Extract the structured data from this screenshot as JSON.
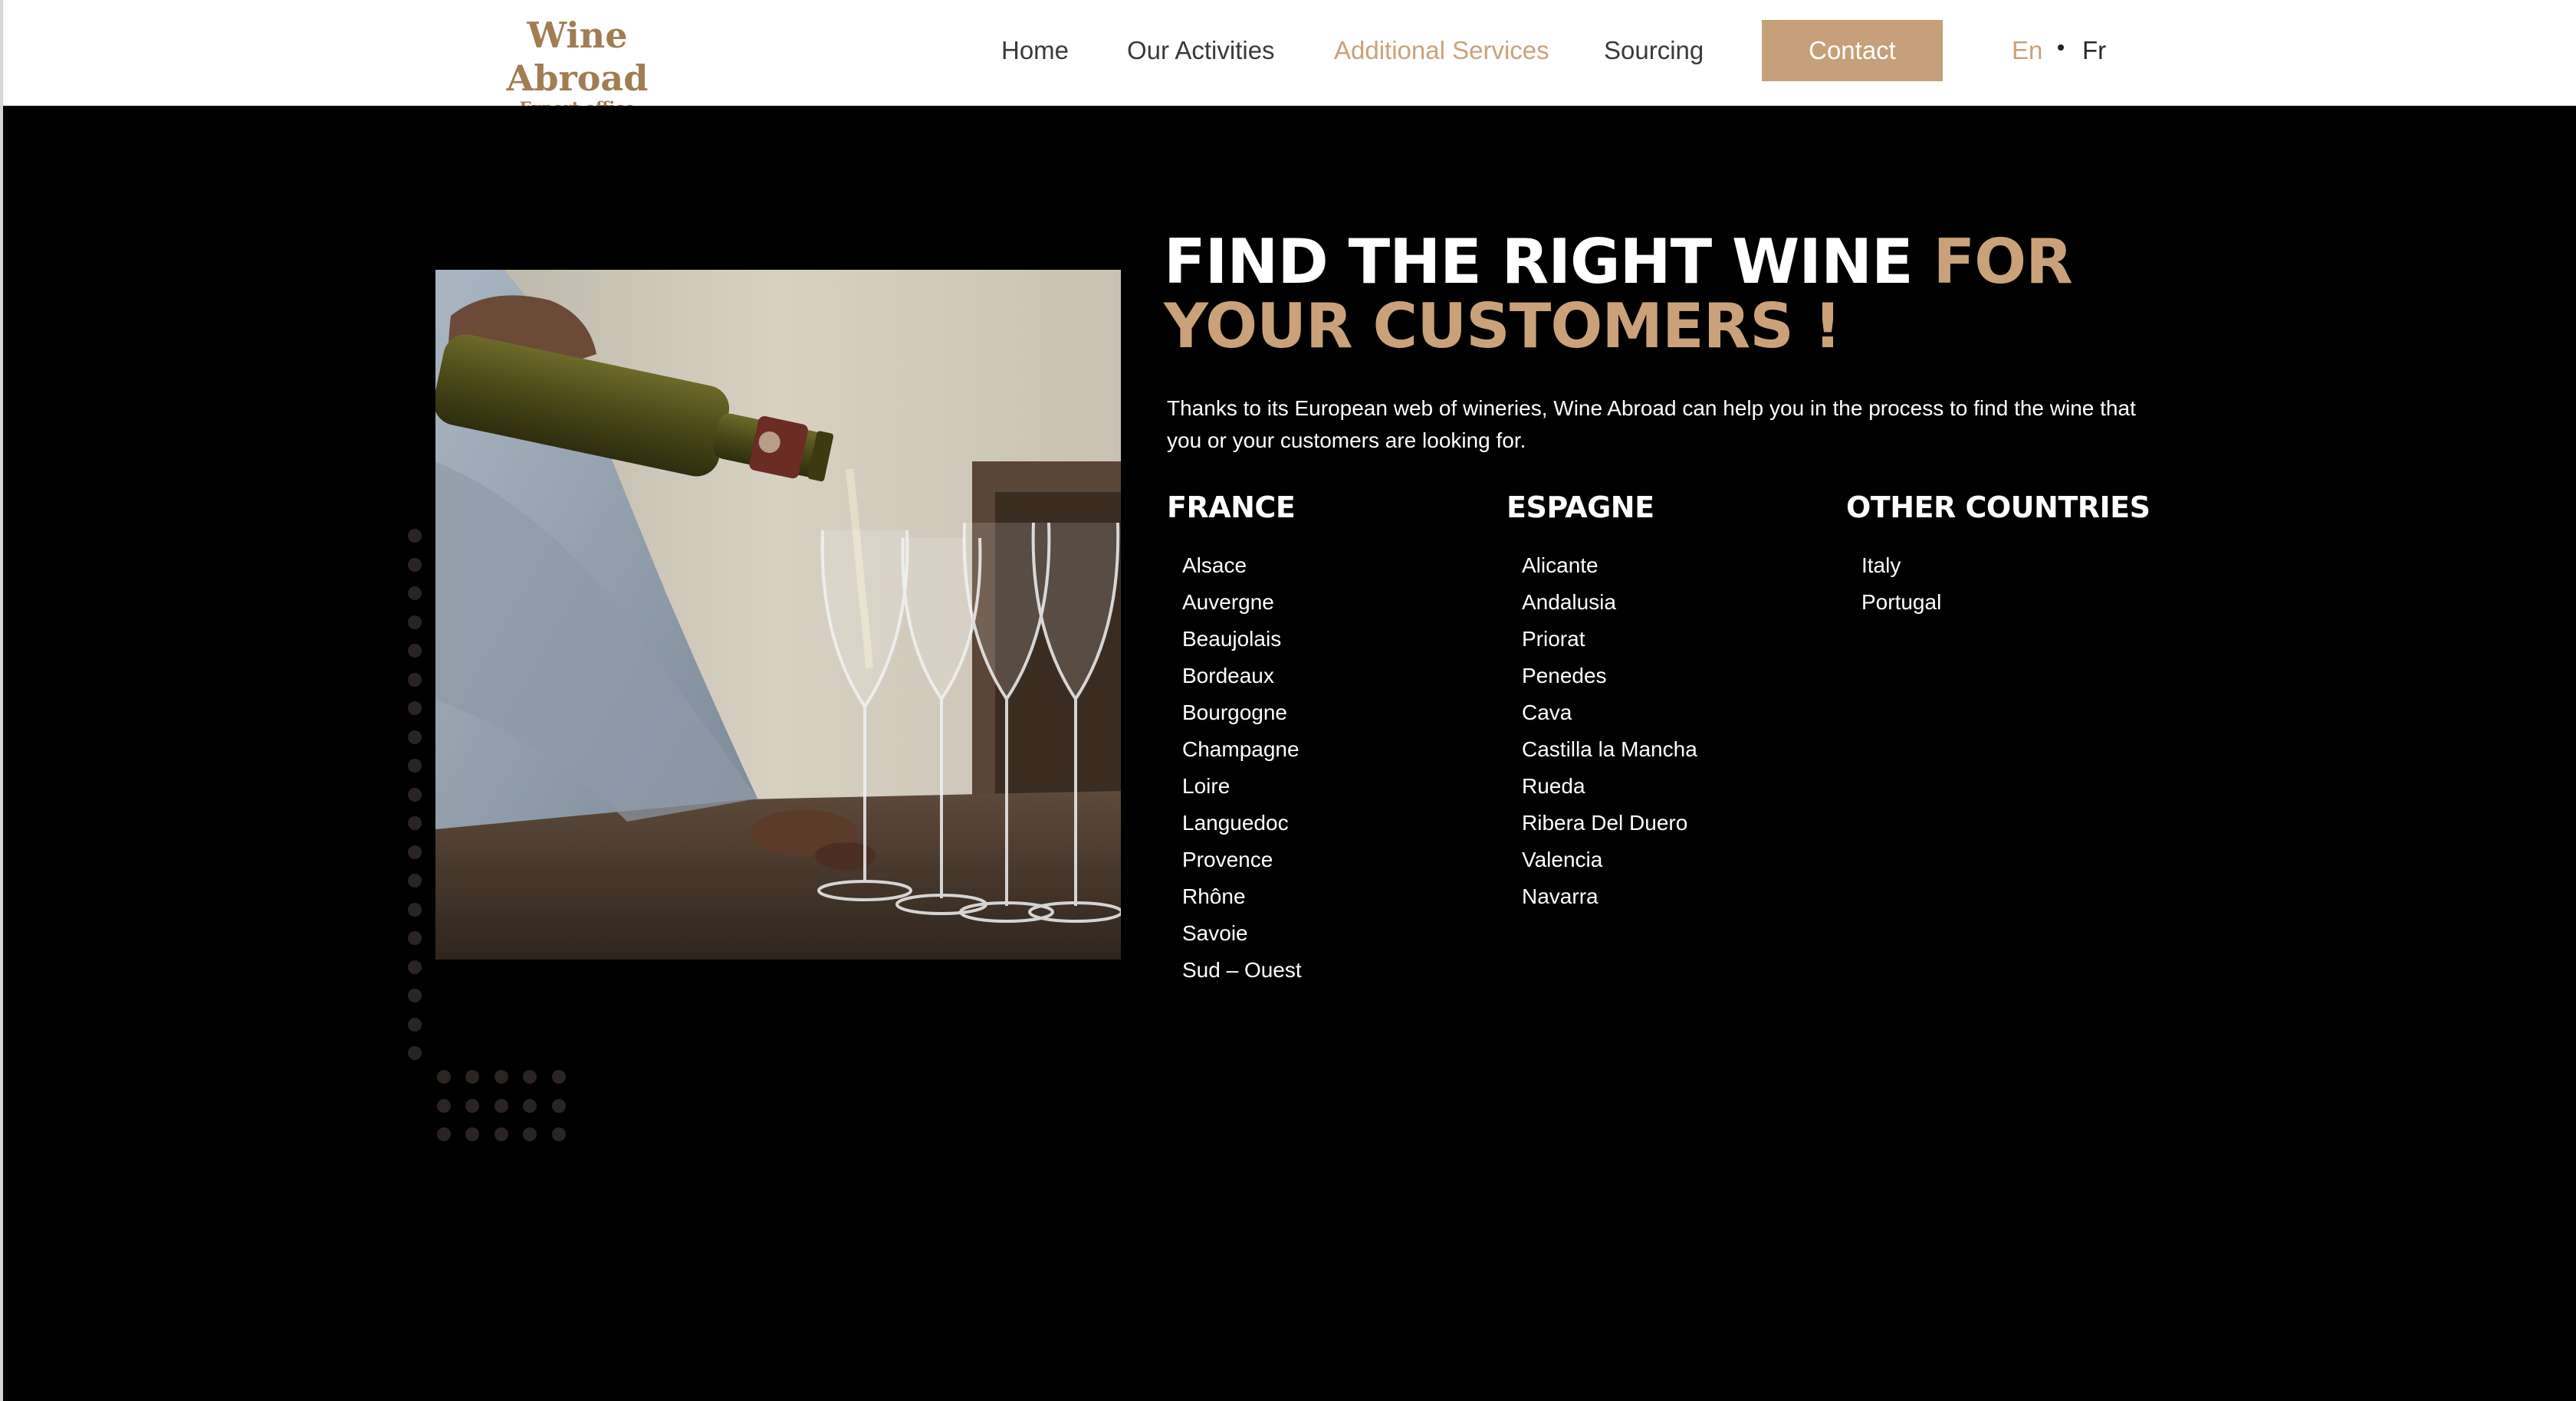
{
  "header": {
    "logo_title": "Wine Abroad",
    "logo_subtitle": "Export office",
    "nav": [
      {
        "label": "Home"
      },
      {
        "label": "Our Activities"
      },
      {
        "label": "Additional Services"
      },
      {
        "label": "Sourcing"
      }
    ],
    "active_nav": "Additional Services",
    "contact_label": "Contact",
    "lang_en": "En",
    "lang_fr": "Fr"
  },
  "hero": {
    "headline_white": "FIND THE RIGHT WINE ",
    "headline_gold": "FOR YOUR CUSTOMERS !",
    "intro": "Thanks to its European web of wineries, Wine Abroad can help you in the process to find the wine that you or your customers are looking for."
  },
  "regions": {
    "france": {
      "title": "FRANCE",
      "items": [
        "Alsace",
        "Auvergne",
        "Beaujolais",
        "Bordeaux",
        "Bourgogne",
        "Champagne",
        "Loire",
        "Languedoc",
        "Provence",
        "Rhône",
        "Savoie",
        "Sud – Ouest"
      ]
    },
    "espagne": {
      "title": "ESPAGNE",
      "items": [
        "Alicante",
        "Andalusia",
        "Priorat",
        "Penedes",
        "Cava",
        "Castilla la Mancha",
        "Rueda",
        "Ribera Del Duero",
        "Valencia",
        "Navarra"
      ]
    },
    "other": {
      "title": "OTHER COUNTRIES",
      "items": [
        "Italy",
        "Portugal"
      ]
    }
  },
  "colors": {
    "accent": "#c9a27a",
    "button": "#c5a07a",
    "logo": "#a07d52",
    "background": "#000000"
  }
}
